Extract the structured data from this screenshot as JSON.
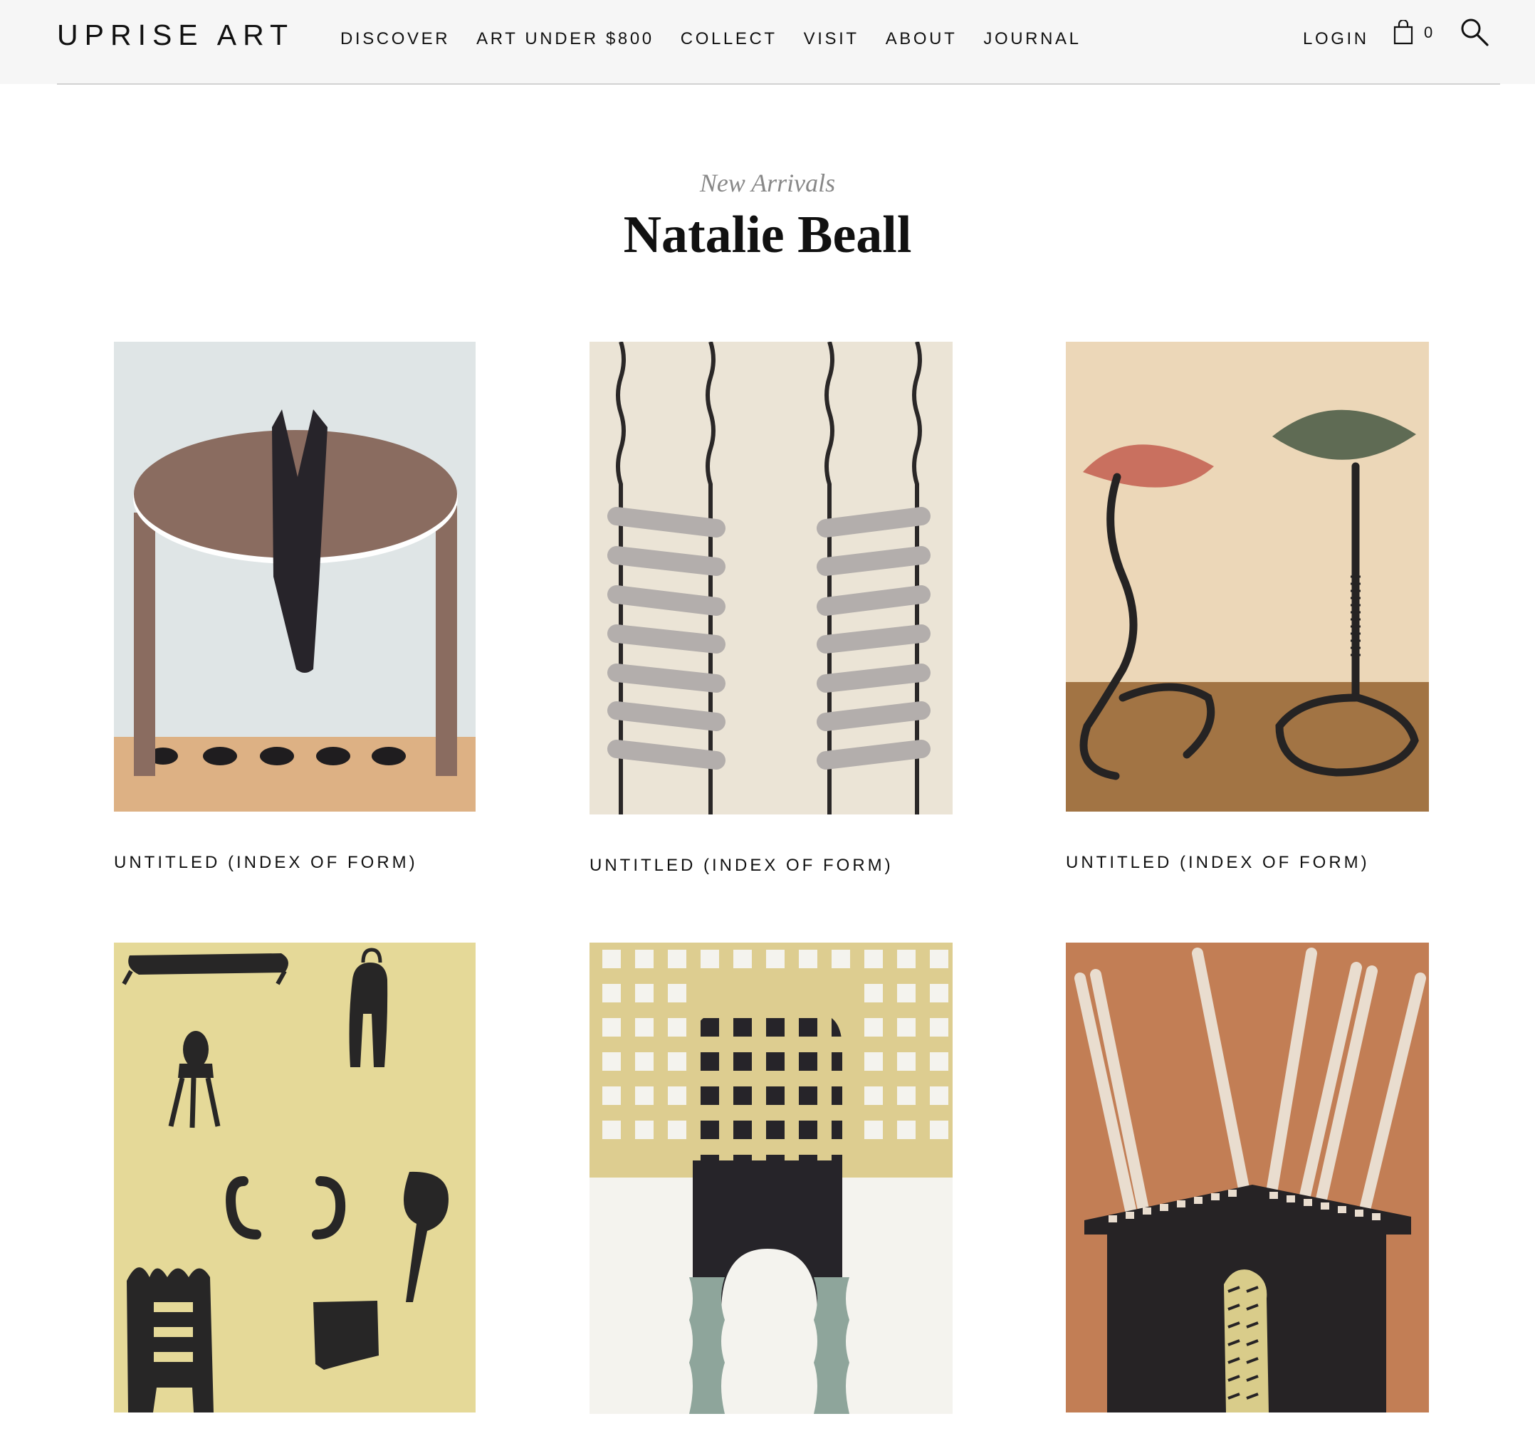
{
  "header": {
    "logo": "UPRISE ART",
    "nav": [
      "DISCOVER",
      "ART UNDER $800",
      "COLLECT",
      "VISIT",
      "ABOUT",
      "JOURNAL"
    ],
    "login": "LOGIN",
    "cart_count": "0"
  },
  "page": {
    "kicker": "New Arrivals",
    "title": "Natalie Beall"
  },
  "artworks": [
    {
      "caption": "UNTITLED (INDEX OF FORM)"
    },
    {
      "caption": "UNTITLED (INDEX OF FORM)"
    },
    {
      "caption": "UNTITLED (INDEX OF FORM)"
    },
    {
      "caption": ""
    },
    {
      "caption": ""
    },
    {
      "caption": ""
    }
  ],
  "colors": {
    "header_bg": "#f6f6f6",
    "ink": "#111111",
    "kicker": "#888888"
  }
}
